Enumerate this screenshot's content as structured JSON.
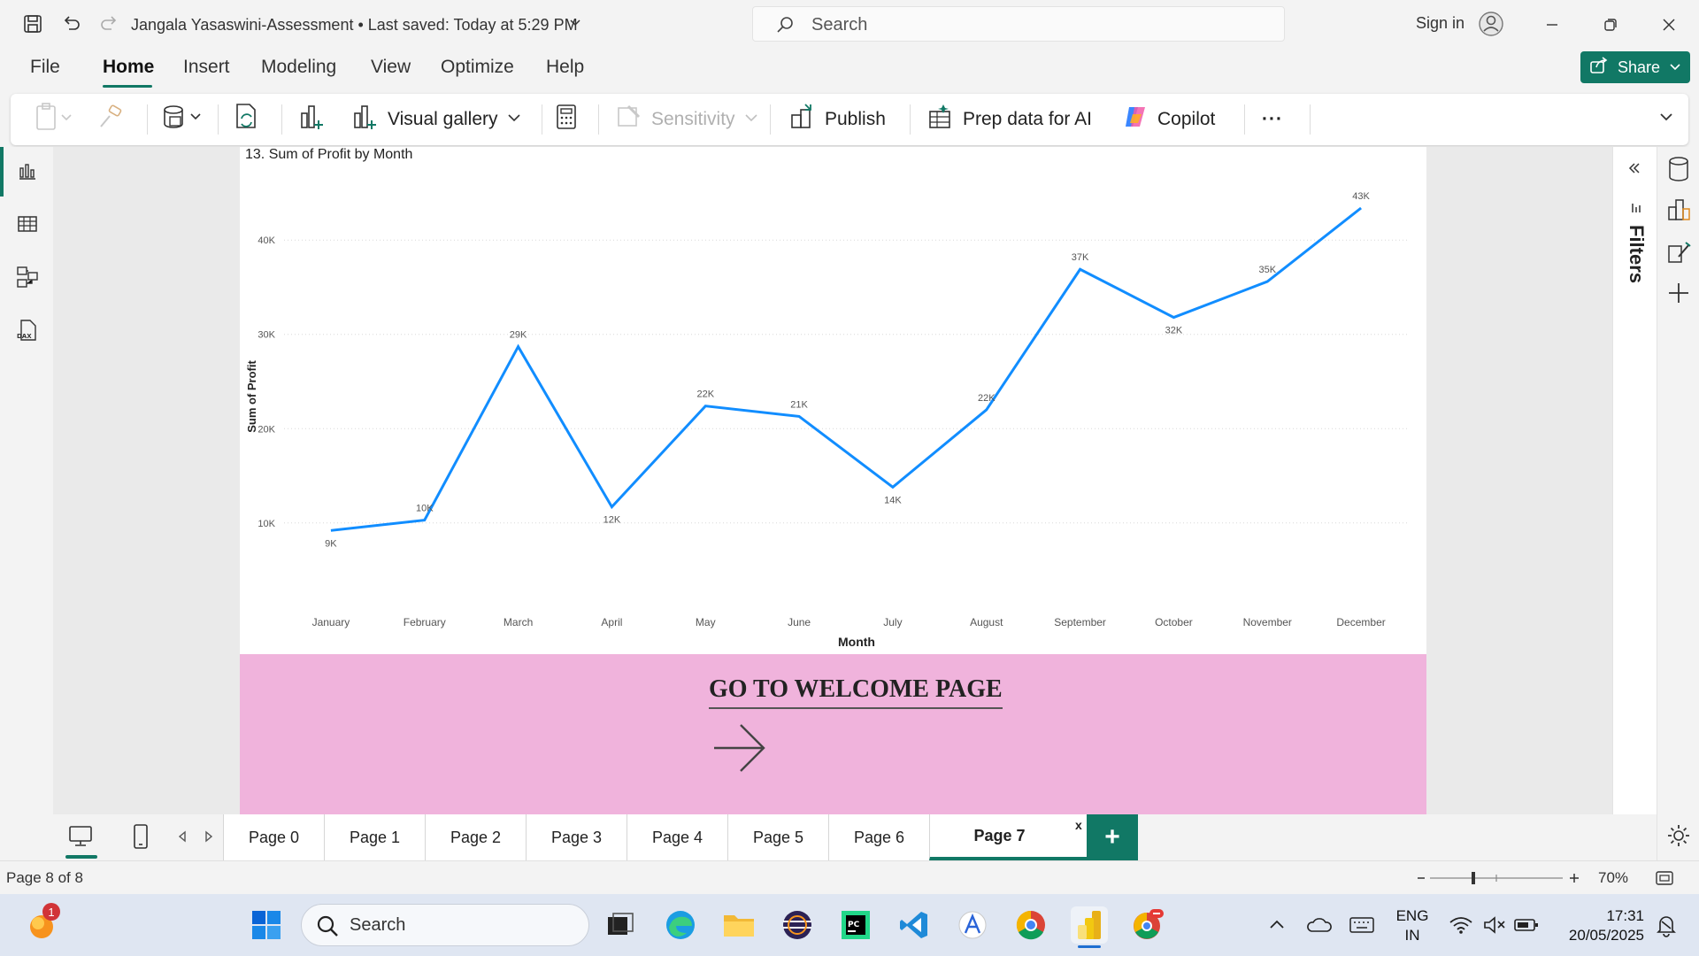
{
  "titlebar": {
    "doc_title": "Jangala Yasaswini-Assessment • Last saved: Today at 5:29 PM",
    "search_placeholder": "Search",
    "sign_in": "Sign in"
  },
  "menu": {
    "items": [
      "File",
      "Home",
      "Insert",
      "Modeling",
      "View",
      "Optimize",
      "Help"
    ],
    "active": "Home",
    "share_label": "Share"
  },
  "ribbon": {
    "visual_gallery": "Visual gallery",
    "sensitivity": "Sensitivity",
    "publish": "Publish",
    "prep_data": "Prep data for AI",
    "copilot": "Copilot",
    "more": "···"
  },
  "chart_data": {
    "type": "line",
    "title": "13. Sum of Profit by Month",
    "xlabel": "Month",
    "ylabel": "Sum of Profit",
    "categories": [
      "January",
      "February",
      "March",
      "April",
      "May",
      "June",
      "July",
      "August",
      "September",
      "October",
      "November",
      "December"
    ],
    "values": [
      9200,
      10300,
      28700,
      11700,
      22400,
      21300,
      13800,
      22000,
      36900,
      31800,
      35600,
      43400
    ],
    "data_labels": [
      "9K",
      "10K",
      "29K",
      "12K",
      "22K",
      "21K",
      "14K",
      "22K",
      "37K",
      "32K",
      "35K",
      "43K"
    ],
    "yticks": [
      "10K",
      "20K",
      "30K",
      "40K"
    ],
    "ytick_values": [
      10000,
      20000,
      30000,
      40000
    ],
    "ylim": [
      2000,
      48000
    ],
    "grid": true,
    "line_color": "#118DFF"
  },
  "welcome": {
    "label": "GO TO WELCOME PAGE"
  },
  "filters": {
    "label": "Filters"
  },
  "pages": {
    "tabs": [
      "Page 0",
      "Page 1",
      "Page 2",
      "Page 3",
      "Page 4",
      "Page 5",
      "Page 6",
      "Page 7"
    ],
    "active": "Page 7",
    "close": "x",
    "add": "+"
  },
  "status": {
    "page_count": "Page 8 of 8",
    "zoom": "70%"
  },
  "taskbar": {
    "search_placeholder": "Search",
    "notification_badge": "1",
    "lang_top": "ENG",
    "lang_bottom": "IN",
    "time": "17:31",
    "date": "20/05/2025"
  },
  "colors": {
    "accent": "#117865",
    "pink_panel": "#f0b3dc",
    "line": "#118DFF"
  }
}
